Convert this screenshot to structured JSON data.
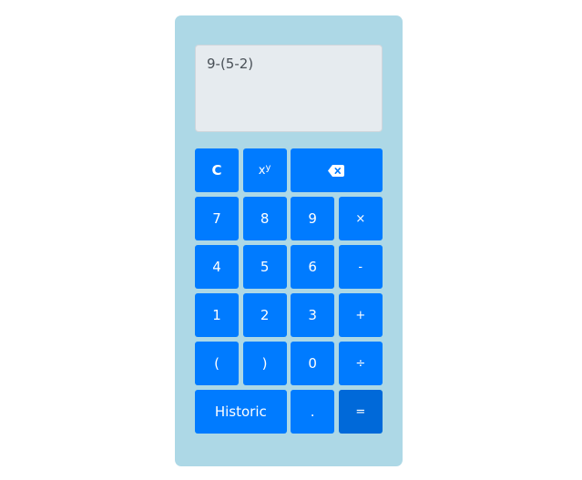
{
  "display": {
    "expression": "9-(5-2)"
  },
  "keys": {
    "clear": "C",
    "power_base": "x",
    "power_exp": "y",
    "backspace_icon": "backspace-icon",
    "seven": "7",
    "eight": "8",
    "nine": "9",
    "multiply": "×",
    "four": "4",
    "five": "5",
    "six": "6",
    "subtract": "-",
    "one": "1",
    "two": "2",
    "three": "3",
    "add": "+",
    "open_paren": "(",
    "close_paren": ")",
    "zero": "0",
    "divide": "÷",
    "historic": "Historic",
    "decimal": ".",
    "equals": "="
  },
  "colors": {
    "panel": "#add8e6",
    "button": "#007bff",
    "equals_button": "#0069d9",
    "display_bg": "#e6ebef"
  }
}
